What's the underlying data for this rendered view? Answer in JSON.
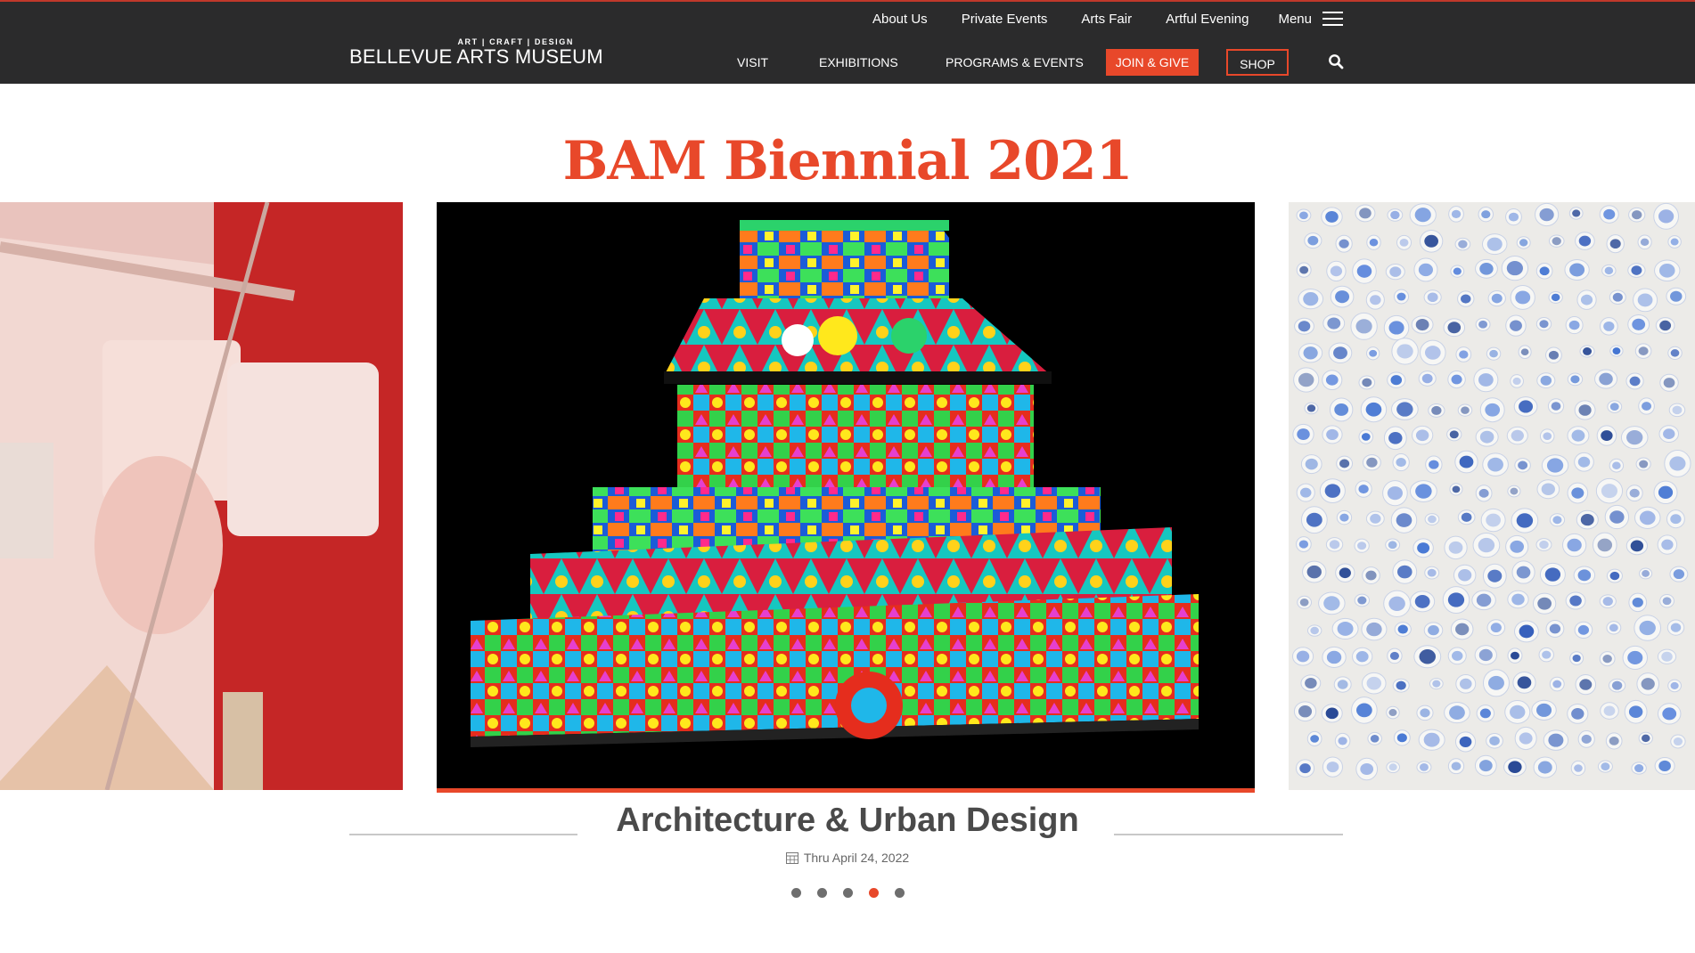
{
  "colors": {
    "accent": "#e8482a",
    "header_bg": "#2b2b2c"
  },
  "utility_nav": [
    "About Us",
    "Private Events",
    "Arts Fair",
    "Artful Evening"
  ],
  "menu_label": "Menu",
  "logo": {
    "tagline": "ART | CRAFT | DESIGN",
    "name": "BELLEVUE ARTS MUSEUM"
  },
  "main_nav": {
    "visit": "VISIT",
    "exhibitions": "EXHIBITIONS",
    "programs": "PROGRAMS & EVENTS",
    "join": "JOIN & GIVE",
    "shop": "SHOP"
  },
  "hero": {
    "title": "BAM Biennial 2021"
  },
  "slide": {
    "title": "Architecture & Urban Design",
    "date": "Thru April 24, 2022"
  },
  "carousel": {
    "dot_count": 5,
    "active_index": 3
  }
}
